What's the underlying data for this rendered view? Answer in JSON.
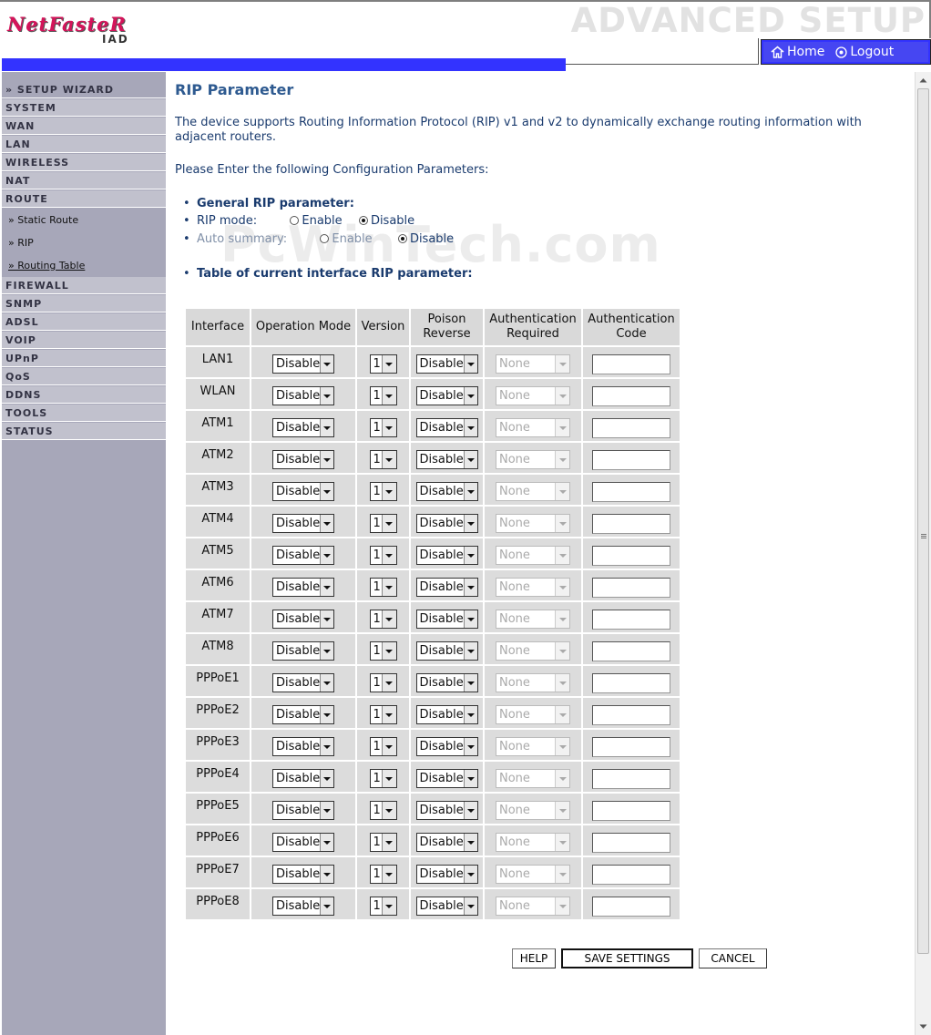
{
  "header": {
    "logo_text": "NetFasteR",
    "logo_sub": "IAD",
    "section_title": "ADVANCED SETUP",
    "nav": {
      "home": "Home",
      "logout": "Logout"
    }
  },
  "sidebar": {
    "setup_wizard": "» SETUP WIZARD",
    "items": [
      "SYSTEM",
      "WAN",
      "LAN",
      "WIRELESS",
      "NAT",
      "ROUTE"
    ],
    "route_subs": [
      "» Static Route",
      "» RIP",
      "» Routing Table"
    ],
    "items2": [
      "FIREWALL",
      "SNMP",
      "ADSL",
      "VOIP",
      "UPnP",
      "QoS",
      "DDNS",
      "TOOLS",
      "STATUS"
    ]
  },
  "main": {
    "title": "RIP Parameter",
    "intro": "The device supports Routing Information Protocol (RIP) v1 and v2 to dynamically exchange routing information with adjacent routers.",
    "prompt": "Please Enter the following Configuration Parameters:",
    "general_heading": "General RIP parameter:",
    "rip_mode_label": "RIP mode:",
    "auto_summary_label": "Auto summary:",
    "enable": "Enable",
    "disable": "Disable",
    "rip_mode_value": "Disable",
    "auto_summary_value": "Disable",
    "table_heading": "Table of current interface RIP parameter:",
    "watermark": "PcWinTech.com"
  },
  "table": {
    "headers": [
      "Interface",
      "Operation Mode",
      "Version",
      "Poison Reverse",
      "Authentication Required",
      "Authentication Code"
    ],
    "rows": [
      {
        "iface": "LAN1",
        "mode": "Disable",
        "version": "1",
        "poison": "Disable",
        "auth": "None",
        "code": ""
      },
      {
        "iface": "WLAN",
        "mode": "Disable",
        "version": "1",
        "poison": "Disable",
        "auth": "None",
        "code": ""
      },
      {
        "iface": "ATM1",
        "mode": "Disable",
        "version": "1",
        "poison": "Disable",
        "auth": "None",
        "code": ""
      },
      {
        "iface": "ATM2",
        "mode": "Disable",
        "version": "1",
        "poison": "Disable",
        "auth": "None",
        "code": ""
      },
      {
        "iface": "ATM3",
        "mode": "Disable",
        "version": "1",
        "poison": "Disable",
        "auth": "None",
        "code": ""
      },
      {
        "iface": "ATM4",
        "mode": "Disable",
        "version": "1",
        "poison": "Disable",
        "auth": "None",
        "code": ""
      },
      {
        "iface": "ATM5",
        "mode": "Disable",
        "version": "1",
        "poison": "Disable",
        "auth": "None",
        "code": ""
      },
      {
        "iface": "ATM6",
        "mode": "Disable",
        "version": "1",
        "poison": "Disable",
        "auth": "None",
        "code": ""
      },
      {
        "iface": "ATM7",
        "mode": "Disable",
        "version": "1",
        "poison": "Disable",
        "auth": "None",
        "code": ""
      },
      {
        "iface": "ATM8",
        "mode": "Disable",
        "version": "1",
        "poison": "Disable",
        "auth": "None",
        "code": ""
      },
      {
        "iface": "PPPoE1",
        "mode": "Disable",
        "version": "1",
        "poison": "Disable",
        "auth": "None",
        "code": ""
      },
      {
        "iface": "PPPoE2",
        "mode": "Disable",
        "version": "1",
        "poison": "Disable",
        "auth": "None",
        "code": ""
      },
      {
        "iface": "PPPoE3",
        "mode": "Disable",
        "version": "1",
        "poison": "Disable",
        "auth": "None",
        "code": ""
      },
      {
        "iface": "PPPoE4",
        "mode": "Disable",
        "version": "1",
        "poison": "Disable",
        "auth": "None",
        "code": ""
      },
      {
        "iface": "PPPoE5",
        "mode": "Disable",
        "version": "1",
        "poison": "Disable",
        "auth": "None",
        "code": ""
      },
      {
        "iface": "PPPoE6",
        "mode": "Disable",
        "version": "1",
        "poison": "Disable",
        "auth": "None",
        "code": ""
      },
      {
        "iface": "PPPoE7",
        "mode": "Disable",
        "version": "1",
        "poison": "Disable",
        "auth": "None",
        "code": ""
      },
      {
        "iface": "PPPoE8",
        "mode": "Disable",
        "version": "1",
        "poison": "Disable",
        "auth": "None",
        "code": ""
      }
    ]
  },
  "buttons": {
    "help": "HELP",
    "save": "SAVE SETTINGS",
    "cancel": "CANCEL"
  },
  "colors": {
    "accent_blue": "#3333ff",
    "sidebar_bg": "#a7a7b9",
    "title_blue": "#2e5a90"
  }
}
